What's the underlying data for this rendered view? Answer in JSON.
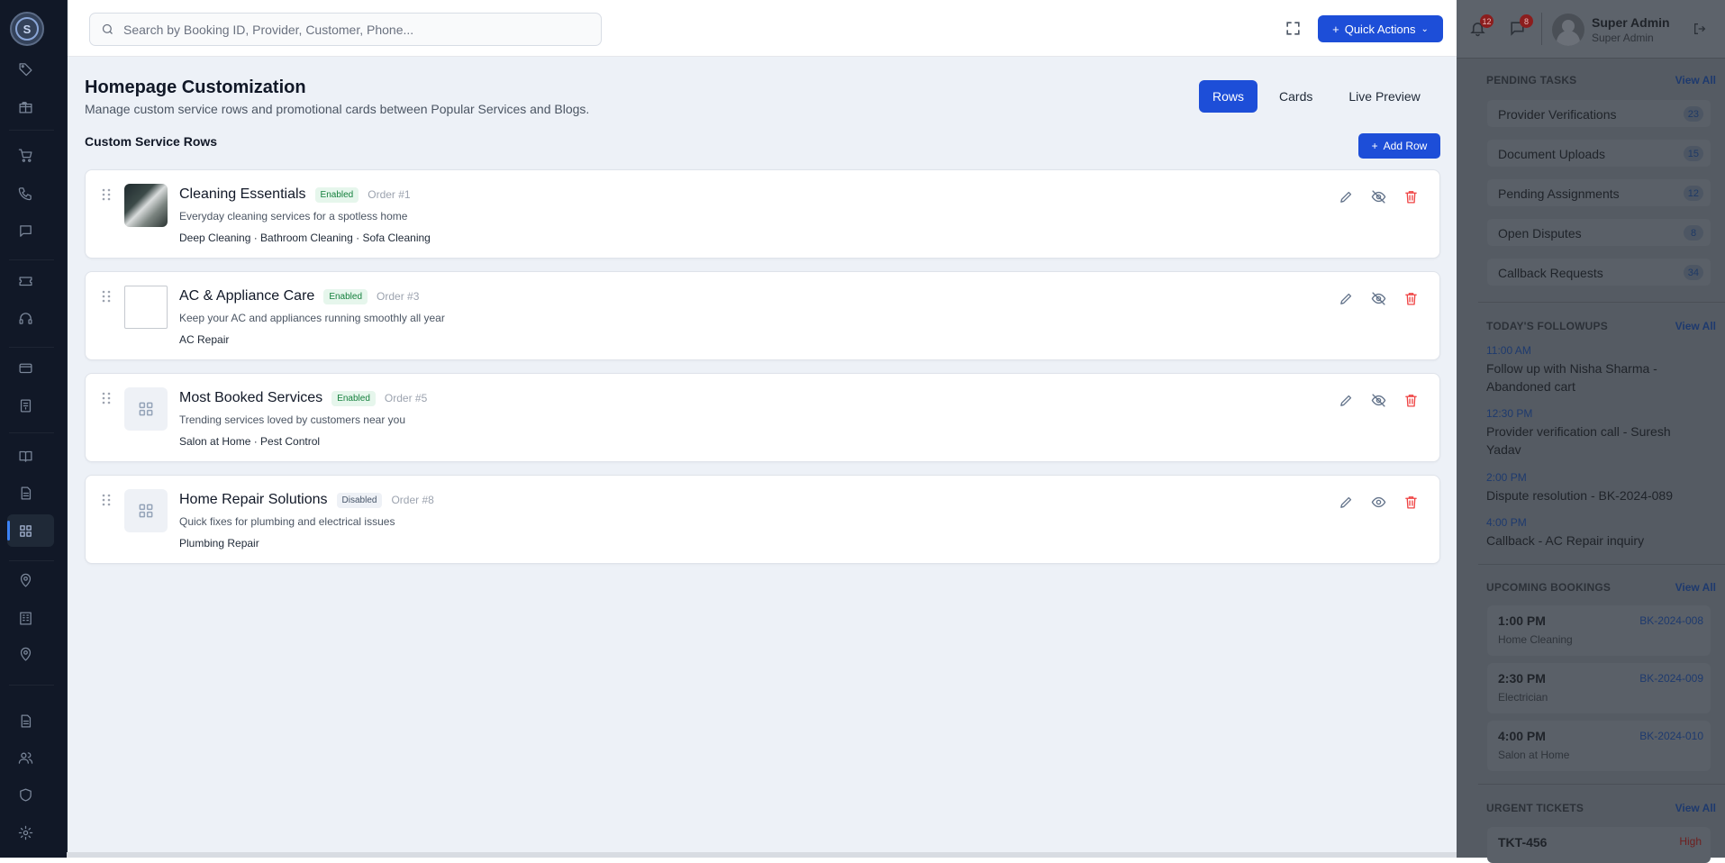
{
  "search": {
    "placeholder": "Search by Booking ID, Provider, Customer, Phone..."
  },
  "header": {
    "quick_actions_label": "Quick Actions"
  },
  "sidebar": {
    "logo_text": "S"
  },
  "page": {
    "title": "Homepage Customization",
    "subtitle": "Manage custom service rows and promotional cards between Popular Services and Blogs.",
    "tabs": [
      {
        "label": "Rows",
        "active": true
      },
      {
        "label": "Cards",
        "active": false
      },
      {
        "label": "Live Preview",
        "active": false
      }
    ],
    "section_title": "Custom Service Rows",
    "add_row_label": "Add Row"
  },
  "rows": [
    {
      "title": "Cleaning Essentials",
      "status": "Enabled",
      "order": "Order #1",
      "description": "Everyday cleaning services for a spotless home",
      "services": "Deep Cleaning · Bathroom Cleaning · Sofa Cleaning",
      "thumb": "photo",
      "visibility_icon": "eye-off-icon"
    },
    {
      "title": "AC & Appliance Care",
      "status": "Enabled",
      "order": "Order #3",
      "description": "Keep your AC and appliances running smoothly all year",
      "services": "AC Repair",
      "thumb": "broken",
      "visibility_icon": "eye-off-icon"
    },
    {
      "title": "Most Booked Services",
      "status": "Enabled",
      "order": "Order #5",
      "description": "Trending services loved by customers near you",
      "services": "Salon at Home · Pest Control",
      "thumb": "placeholder",
      "visibility_icon": "eye-off-icon"
    },
    {
      "title": "Home Repair Solutions",
      "status": "Disabled",
      "order": "Order #8",
      "description": "Quick fixes for plumbing and electrical issues",
      "services": "Plumbing Repair",
      "thumb": "placeholder",
      "visibility_icon": "eye-icon"
    }
  ],
  "user": {
    "name": "Super Admin",
    "role": "Super Admin",
    "notifications": "12",
    "messages": "8"
  },
  "right_panel": {
    "pending_tasks": {
      "title": "PENDING TASKS",
      "view_all": "View All",
      "items": [
        {
          "label": "Provider Verifications",
          "count": "23"
        },
        {
          "label": "Document Uploads",
          "count": "15"
        },
        {
          "label": "Pending Assignments",
          "count": "12"
        },
        {
          "label": "Open Disputes",
          "count": "8"
        },
        {
          "label": "Callback Requests",
          "count": "34"
        }
      ]
    },
    "followups": {
      "title": "TODAY'S FOLLOWUPS",
      "view_all": "View All",
      "items": [
        {
          "time": "11:00 AM",
          "text": "Follow up with Nisha Sharma - Abandoned cart"
        },
        {
          "time": "12:30 PM",
          "text": "Provider verification call - Suresh Yadav"
        },
        {
          "time": "2:00 PM",
          "text": "Dispute resolution - BK-2024-089"
        },
        {
          "time": "4:00 PM",
          "text": "Callback - AC Repair inquiry"
        }
      ]
    },
    "bookings": {
      "title": "UPCOMING BOOKINGS",
      "view_all": "View All",
      "items": [
        {
          "time": "1:00 PM",
          "service": "Home Cleaning",
          "id": "BK-2024-008"
        },
        {
          "time": "2:30 PM",
          "service": "Electrician",
          "id": "BK-2024-009"
        },
        {
          "time": "4:00 PM",
          "service": "Salon at Home",
          "id": "BK-2024-010"
        }
      ]
    },
    "tickets": {
      "title": "URGENT TICKETS",
      "view_all": "View All",
      "items": [
        {
          "id": "TKT-456",
          "priority": "High"
        }
      ]
    }
  }
}
